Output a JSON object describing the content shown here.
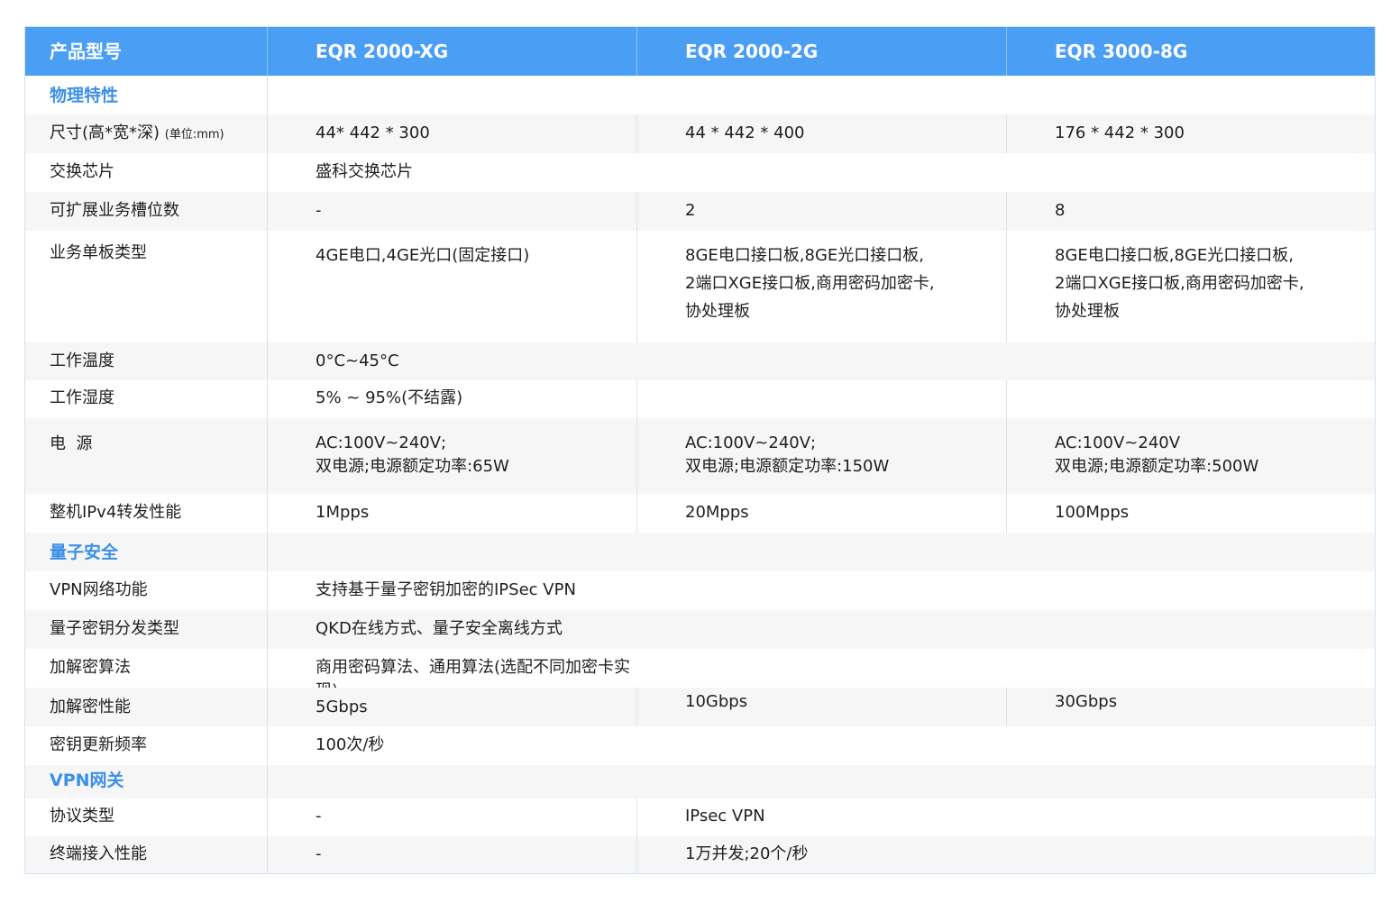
{
  "header": [
    "产品型号",
    "EQR 2000-XG",
    "EQR 2000-2G",
    "EQR 3000-8G"
  ],
  "sections": {
    "physical": "物理特性",
    "quantum": "量子安全",
    "vpn": "VPN网关"
  },
  "rows": {
    "size": {
      "label": "尺寸(高*宽*深)",
      "unit": "(单位:mm)",
      "values": [
        "44* 442 * 300",
        "44 * 442 * 400",
        "176 * 442 * 300"
      ]
    },
    "chip": {
      "label": "交换芯片",
      "values": [
        "盛科交换芯片"
      ]
    },
    "slots": {
      "label": "可扩展业务槽位数",
      "values": [
        "-",
        "2",
        "8"
      ]
    },
    "boards": {
      "label": "业务单板类型",
      "values": [
        "4GE电口,4GE光口(固定接口)",
        "8GE电口接口板,8GE光口接口板,\n2端口XGE接口板,商用密码加密卡,\n协处理板",
        "8GE电口接口板,8GE光口接口板,\n2端口XGE接口板,商用密码加密卡,\n协处理板"
      ]
    },
    "temp": {
      "label": "工作温度",
      "values": [
        "0°C~45°C"
      ]
    },
    "humidity": {
      "label": "工作湿度",
      "values": [
        "5% ~ 95%(不结露)"
      ]
    },
    "power": {
      "label": "电  源",
      "values": [
        "AC:100V~240V;\n双电源;电源额定功率:65W",
        "AC:100V~240V;\n双电源;电源额定功率:150W",
        "AC:100V~240V\n双电源;电源额定功率:500W"
      ]
    },
    "forwarding": {
      "label": "整机IPv4转发性能",
      "values": [
        "1Mpps",
        "20Mpps",
        "100Mpps"
      ]
    },
    "vpnfunc": {
      "label": "VPN网络功能",
      "values": [
        "支持基于量子密钥加密的IPSec VPN"
      ]
    },
    "keydist": {
      "label": "量子密钥分发类型",
      "values": [
        "QKD在线方式、量子安全离线方式"
      ]
    },
    "algo": {
      "label": "加解密算法",
      "values": [
        "商用密码算法、通用算法(选配不同加密卡实现)"
      ]
    },
    "perf": {
      "label": "加解密性能",
      "values": [
        "5Gbps",
        "10Gbps",
        "30Gbps"
      ]
    },
    "keyrate": {
      "label": "密钥更新频率",
      "values": [
        "100次/秒"
      ]
    },
    "protocol": {
      "label": "协议类型",
      "values": [
        "-",
        "IPsec VPN"
      ]
    },
    "terminal": {
      "label": "终端接入性能",
      "values": [
        "-",
        "1万并发;20个/秒"
      ]
    }
  }
}
